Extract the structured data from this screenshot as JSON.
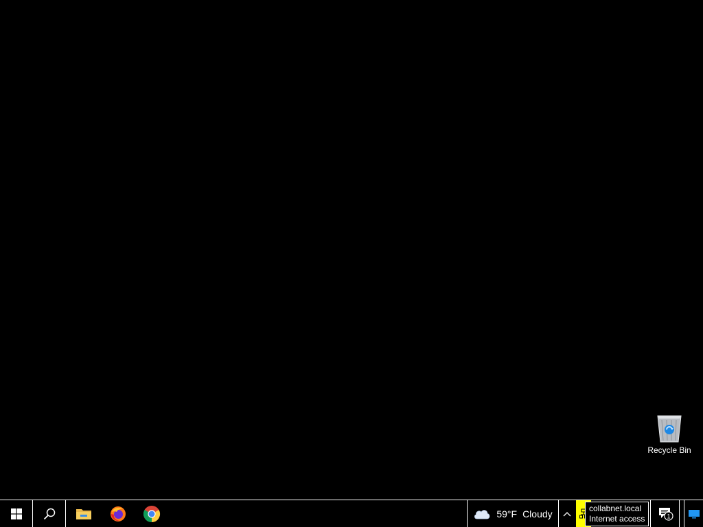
{
  "desktop": {
    "icons": [
      {
        "label": "Recycle Bin",
        "icon": "recycle-bin-icon"
      }
    ]
  },
  "taskbar": {
    "start": {
      "icon": "windows-logo-icon"
    },
    "search": {
      "icon": "search-icon"
    },
    "pinned": [
      {
        "name": "File Explorer",
        "icon": "folder-icon"
      },
      {
        "name": "Firefox",
        "icon": "firefox-icon"
      },
      {
        "name": "Google Chrome",
        "icon": "chrome-icon"
      }
    ],
    "weather": {
      "icon": "cloud-icon",
      "temperature": "59°F",
      "condition": "Cloudy"
    },
    "tray": {
      "chevron_icon": "chevron-up-icon",
      "network_icon": "network-icon",
      "notifications_count": "1"
    }
  },
  "tooltip": {
    "line1": "collabnet.local",
    "line2": "Internet access"
  },
  "colors": {
    "desktop_bg": "#000000",
    "taskbar_bg": "#000000",
    "highlight": "#ffff00",
    "text": "#ffffff"
  }
}
